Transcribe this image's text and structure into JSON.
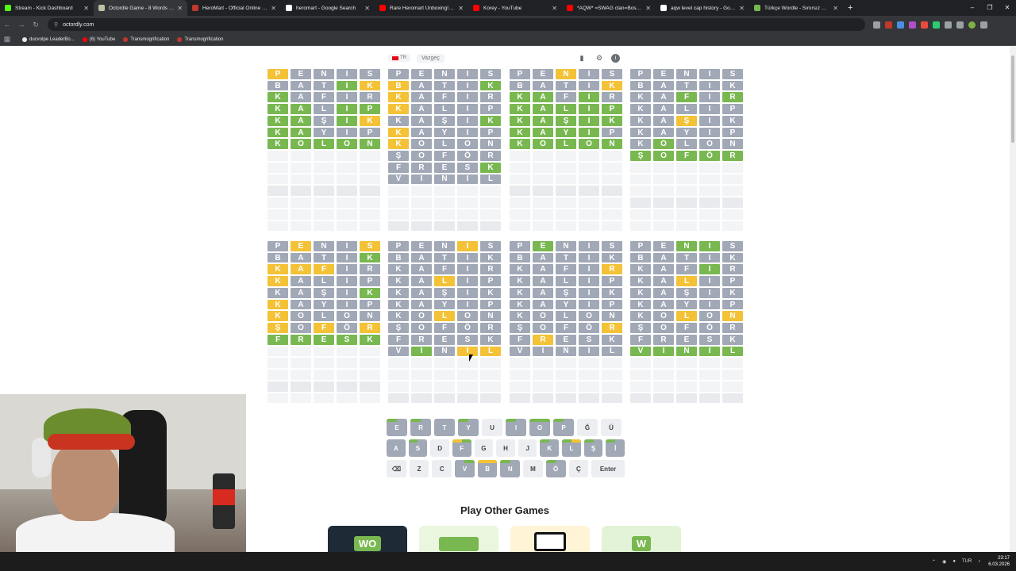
{
  "browser": {
    "tabs": [
      {
        "title": "Stream - Kick Dashboard",
        "color": "#53fc18"
      },
      {
        "title": "Octordle Game - 8 Words Wor...",
        "color": "#b9c4a2",
        "active": true
      },
      {
        "title": "HeroMart - Official Online Sho...",
        "color": "#c0392b"
      },
      {
        "title": "heromart - Google Search",
        "color": "#ffffff"
      },
      {
        "title": "Rare Heromart Unboxing! First...",
        "color": "#ff0000"
      },
      {
        "title": "Korey - YouTube",
        "color": "#ff0000"
      },
      {
        "title": "*AQW* =SWAG clan=Boss Batt...",
        "color": "#ff0000"
      },
      {
        "title": "aqw level cap history - Google",
        "color": "#ffffff"
      },
      {
        "title": "Türkçe Wordle - Sınırsız Oyna",
        "color": "#79b851"
      }
    ],
    "url": "octordly.com",
    "bookmarks": [
      {
        "label": "ducvolpe LeaderBo...",
        "color": "#e8eaed"
      },
      {
        "label": "(6) YouTube",
        "color": "#ff0000"
      },
      {
        "label": "Transmogrification",
        "color": "#c0392b"
      },
      {
        "label": "Transmogrification",
        "color": "#c0392b"
      }
    ]
  },
  "game": {
    "language": "TR",
    "give_up": "Vazgeç",
    "icons": [
      "chart-icon",
      "gear-icon",
      "info-icon"
    ],
    "boards": [
      {
        "rows": [
          [
            "P",
            "E",
            "N",
            "I",
            "S",
            "yx..."
          ]
        ]
      }
    ],
    "grids": [
      [
        "yxxxx",
        "xxxgy",
        "gxxxx",
        "ggxgg",
        "ggxgy",
        "ggxxx",
        "ggggg"
      ],
      [
        "xxxxx",
        "yxxxg",
        "yxxxx",
        "yxxxx",
        "xxxxg",
        "yxxxx",
        "yxxxx",
        "xxxxx",
        "xxxxg",
        "xxxxx"
      ],
      [
        "xxyxx",
        "xxxxy",
        "ggxgx",
        "ggggg",
        "ggggg",
        "ggggx",
        "ggggg"
      ],
      [
        "xxxxx",
        "xxxxx",
        "xxgxg",
        "xxxxx",
        "xxyxx",
        "xxxxx",
        "xgxxx",
        "ggggg"
      ],
      [
        "xyxxy",
        "xxxxg",
        "yyyxx",
        "yxxxx",
        "xxxxg",
        "yxxxx",
        "yxxxx",
        "yxyxy",
        "ggggg"
      ],
      [
        "xxxyx",
        "xxxxx",
        "xxxxx",
        "xxyxx",
        "xxxxx",
        "xxxxx",
        "xxyxx",
        "xxxxx",
        "xxxxx",
        "xgxyy"
      ],
      [
        "xgxxx",
        "xxxxx",
        "xxxxy",
        "xxxxx",
        "xxxxx",
        "xxxxx",
        "xxxxx",
        "xxxxy",
        "xyxxx",
        "xxxxx"
      ],
      [
        "xxggx",
        "xxxxx",
        "xxxgx",
        "xxyxx",
        "xxxxx",
        "xxxxx",
        "xxyxy",
        "xxxxx",
        "xxxxx",
        "ggggg"
      ]
    ],
    "words": [
      "PENIS",
      "BATIK",
      "KAFIR",
      "KALIP",
      "KAŞIK",
      "KAYIP",
      "KOLON",
      "ŞOFÖR",
      "FRESK",
      "VINIL"
    ],
    "board_guesses": [
      6,
      10,
      7,
      8,
      9,
      10,
      10,
      10
    ],
    "keyboard": {
      "rows": [
        [
          "E",
          "R",
          "T",
          "Y",
          "U",
          "I",
          "O",
          "P",
          "Ğ",
          "Ü"
        ],
        [
          "A",
          "S",
          "D",
          "F",
          "G",
          "H",
          "J",
          "K",
          "L",
          "Ş",
          "İ"
        ],
        [
          "⌫",
          "Z",
          "C",
          "V",
          "B",
          "N",
          "M",
          "Ö",
          "Ç",
          "Enter"
        ]
      ],
      "used": [
        "E",
        "R",
        "T",
        "Y",
        "I",
        "O",
        "P",
        "A",
        "S",
        "F",
        "K",
        "L",
        "Ş",
        "İ",
        "V",
        "B",
        "N",
        "Ö"
      ]
    },
    "other_games_title": "Play Other Games",
    "other_games": [
      {
        "label": "WO",
        "color": "#1f2a37",
        "fg": "#79b851"
      },
      {
        "label": "",
        "color": "#eaf6de",
        "fg": "#79b851"
      },
      {
        "label": "",
        "color": "#fff4d6",
        "fg": "#111"
      },
      {
        "label": "W",
        "color": "#e2f3d8",
        "fg": "#111"
      }
    ]
  },
  "taskbar": {
    "lang": "TUR",
    "time": "23:17",
    "date": "6.03.2026"
  }
}
